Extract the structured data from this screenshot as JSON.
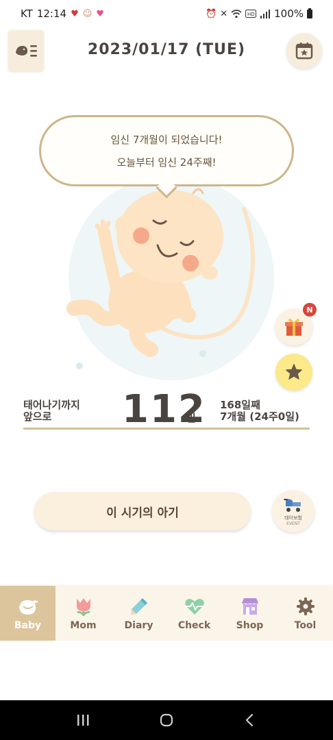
{
  "status_bar": {
    "carrier": "KT",
    "time": "12:14",
    "battery": "100%"
  },
  "header": {
    "date": "2023/01/17 (TUE)"
  },
  "bubble": {
    "line1": "임신 7개월이 되었습니다!",
    "line2": "오늘부터 임신 24주째!"
  },
  "gift": {
    "badge": "N"
  },
  "countdown": {
    "prefix_line1": "태어나기까지",
    "prefix_line2": "앞으로",
    "days_left": "112",
    "unit": "일",
    "days_count": "168일째",
    "months_weeks": "7개월 (24주0일)"
  },
  "period_button": {
    "label": "이 시기의 아기"
  },
  "event_button": {
    "label": "태아보험",
    "sub": "EVENT"
  },
  "colors": {
    "accent": "#dcc59c",
    "bubble_border": "#cdb58a",
    "badge_red": "#d6473e",
    "star_yellow": "#fbe98a"
  },
  "bottom_nav": [
    {
      "label": "Baby",
      "icon": "bird-icon"
    },
    {
      "label": "Mom",
      "icon": "tulip-icon"
    },
    {
      "label": "Diary",
      "icon": "pencil-icon"
    },
    {
      "label": "Check",
      "icon": "heartbeat-icon"
    },
    {
      "label": "Shop",
      "icon": "shop-icon"
    },
    {
      "label": "Tool",
      "icon": "gear-icon"
    }
  ]
}
